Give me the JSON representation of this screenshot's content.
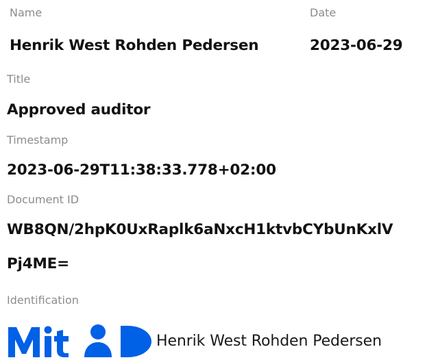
{
  "fields": {
    "name_label": "Name",
    "name_value": "Henrik West Rohden Pedersen",
    "date_label": "Date",
    "date_value": "2023-06-29",
    "title_label": "Title",
    "title_value": "Approved auditor",
    "timestamp_label": "Timestamp",
    "timestamp_value": "2023-06-29T11:38:33.778+02:00",
    "document_id_label": "Document ID",
    "document_id_line1": "WB8QN/2hpK0UxRaplk6aNxcH1ktvbCYbUnKxlV",
    "document_id_line2": "Pj4ME=",
    "identification_label": "Identification"
  },
  "identification": {
    "logo_icon": "mitid-logo-icon",
    "logo_text": "MitID",
    "logo_color": "#0060e6",
    "person_name": "Henrik West Rohden Pedersen"
  }
}
